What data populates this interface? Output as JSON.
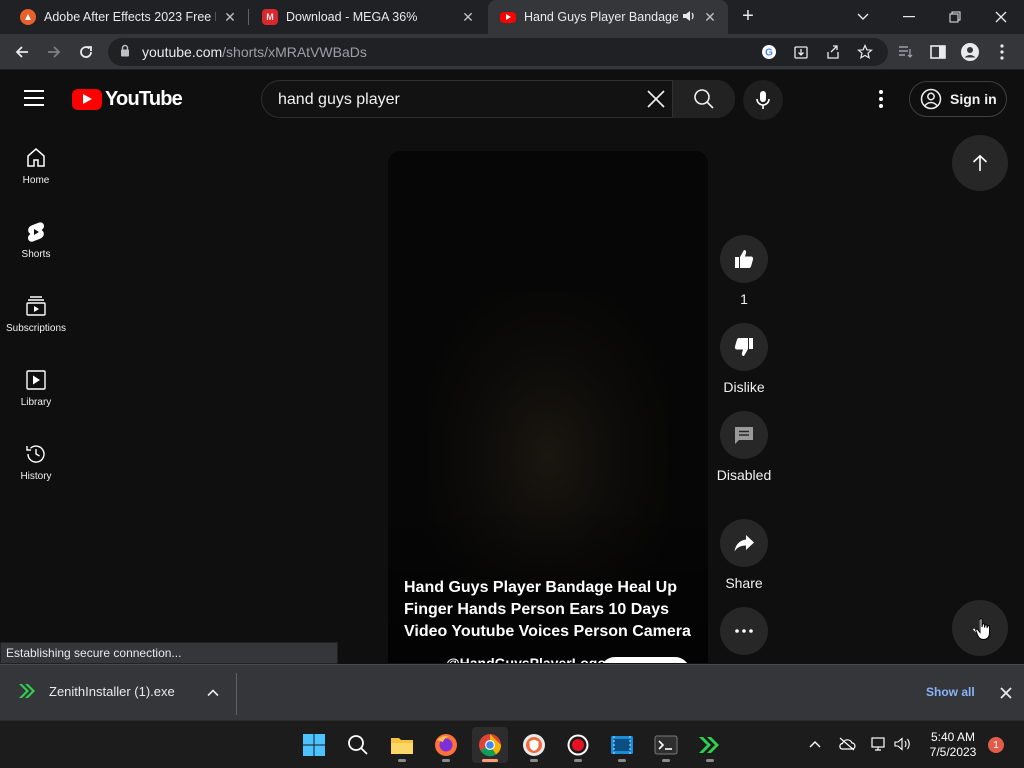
{
  "browser": {
    "tabs": [
      {
        "title": "Adobe After Effects 2023 Free Do",
        "favicon": "adobe-icon",
        "active": false
      },
      {
        "title": "Download - MEGA 36%",
        "favicon": "mega-icon",
        "active": false
      },
      {
        "title": "Hand Guys Player Bandage H",
        "favicon": "youtube-icon",
        "active": true,
        "audio": true
      }
    ],
    "url_host": "youtube.com",
    "url_path": "/shorts/xMRAtVWBaDs"
  },
  "masthead": {
    "logo_text": "YouTube",
    "search_query": "hand guys player",
    "signin_label": "Sign in"
  },
  "sidebar": {
    "items": [
      {
        "label": "Home",
        "icon": "home-icon"
      },
      {
        "label": "Shorts",
        "icon": "shorts-icon"
      },
      {
        "label": "Subscriptions",
        "icon": "subscriptions-icon"
      },
      {
        "label": "Library",
        "icon": "library-icon"
      },
      {
        "label": "History",
        "icon": "history-icon"
      }
    ]
  },
  "short": {
    "title": "Hand Guys Player Bandage Heal Up Finger Hands Person Ears 10 Days Video Youtube Voices Person Camera",
    "channel": "@HandGuysPlayerLogo"
  },
  "actions": {
    "like_count": "1",
    "dislike_label": "Dislike",
    "comments_label": "Disabled",
    "share_label": "Share"
  },
  "status_text": "Establishing secure connection...",
  "downloads": {
    "file": "ZenithInstaller (1).exe",
    "show_all": "Show all"
  },
  "taskbar": {
    "time": "5:40 AM",
    "date": "7/5/2023",
    "notifications": "1"
  },
  "colors": {
    "youtube_red": "#ff0000",
    "link_blue": "#8ab4f8",
    "chip_bg": "#272727"
  }
}
